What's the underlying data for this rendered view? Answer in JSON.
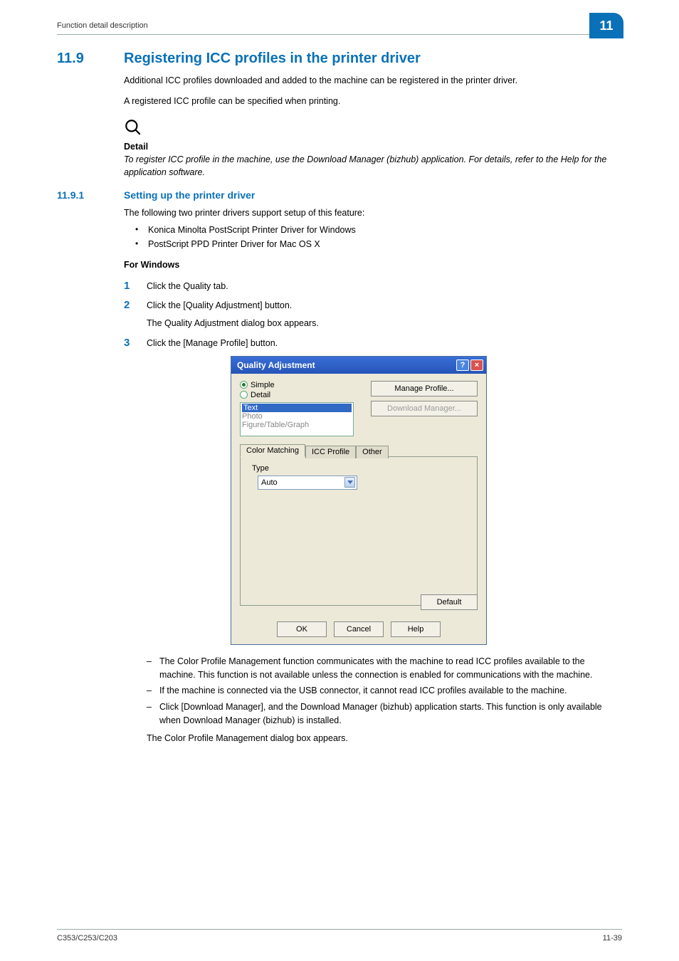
{
  "header": {
    "running": "Function detail description",
    "chapter": "11"
  },
  "section": {
    "num": "11.9",
    "title": "Registering ICC profiles in the printer driver"
  },
  "intro": {
    "p1": "Additional ICC profiles downloaded and added to the machine can be registered in the printer driver.",
    "p2": "A registered ICC profile can be specified when printing."
  },
  "detail": {
    "label": "Detail",
    "text": "To register ICC profile in the machine, use the Download Manager (bizhub) application. For details, refer to the Help for the application software."
  },
  "subsec": {
    "num": "11.9.1",
    "title": "Setting up the printer driver",
    "lead": "The following two printer drivers support setup of this feature:",
    "bullets": {
      "0": "Konica Minolta PostScript Printer Driver for Windows",
      "1": "PostScript PPD Printer Driver for Mac OS X"
    }
  },
  "win": {
    "heading": "For Windows",
    "steps": {
      "1": "Click the Quality tab.",
      "2": "Click the [Quality Adjustment] button.",
      "2b": "The Quality Adjustment dialog box appears.",
      "3": "Click the [Manage Profile] button."
    },
    "dashes": {
      "0": "The Color Profile Management function communicates with the machine to read ICC profiles available to the machine. This function is not available unless the connection is enabled for communications with the machine.",
      "1": "If the machine is connected via the USB connector, it cannot read ICC profiles available to the machine.",
      "2": "Click [Download Manager], and the Download Manager (bizhub) application starts. This function is only available when Download Manager (bizhub) is installed."
    },
    "after": "The Color Profile Management dialog box appears."
  },
  "dialog": {
    "title": "Quality Adjustment",
    "winbtns": {
      "help": "?",
      "close": "×"
    },
    "radios": {
      "simple": "Simple",
      "detail": "Detail"
    },
    "list": {
      "0": "Text",
      "1": "Photo",
      "2": "Figure/Table/Graph"
    },
    "buttons": {
      "manage": "Manage Profile...",
      "download": "Download Manager...",
      "default": "Default",
      "ok": "OK",
      "cancel": "Cancel",
      "help": "Help"
    },
    "tabs": {
      "match": "Color Matching",
      "icc": "ICC Profile",
      "other": "Other"
    },
    "type": {
      "label": "Type",
      "value": "Auto"
    }
  },
  "footer": {
    "left": "C353/C253/C203",
    "right": "11-39"
  }
}
